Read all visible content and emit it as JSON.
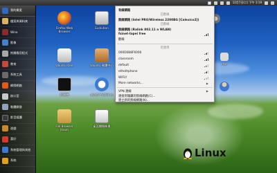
{
  "top_panel": {
    "clock": "12月7日(二) 下午 3:19"
  },
  "launcher": {
    "items": [
      {
        "label": "我的最愛",
        "color": "#2d6ac6",
        "icon": "star-icon"
      },
      {
        "label": "檔案與資料夾",
        "color": "#d9b360",
        "icon": "folder-icon"
      },
      {
        "label": "Wine",
        "color": "#8b2a2a",
        "icon": "wine-icon"
      },
      {
        "label": "影像",
        "color": "#4a7dc9",
        "icon": "image-icon"
      },
      {
        "label": "附屬應用程式",
        "color": "#a6a6a6",
        "icon": "accessories-icon"
      },
      {
        "label": "教育",
        "color": "#c64a3a",
        "icon": "education-icon"
      },
      {
        "label": "系統工具",
        "color": "#6a6a6a",
        "icon": "system-tools-icon"
      },
      {
        "label": "網際網路",
        "color": "#e05a18",
        "icon": "internet-icon"
      },
      {
        "label": "辦公室",
        "color": "#c8c8c8",
        "icon": "office-icon"
      },
      {
        "label": "軟體開發",
        "color": "#8fa3bd",
        "icon": "development-icon"
      },
      {
        "label": "影音媒體",
        "color": "#3a3a3a",
        "icon": "media-icon"
      },
      {
        "label": "遊戲",
        "color": "#c98a2a",
        "icon": "games-icon"
      },
      {
        "label": "喜好",
        "color": "#d23a2a",
        "icon": "preferences-icon"
      },
      {
        "label": "系統管理與其他",
        "color": "#3a7ad0",
        "icon": "administration-icon"
      },
      {
        "label": "系統",
        "color": "#e0a020",
        "icon": "system-icon"
      }
    ]
  },
  "desktop": {
    "icons": [
      {
        "label": "Firefox Web Browser",
        "color": "#e0641c"
      },
      {
        "label": "Evolution",
        "color": "#c6c6c6"
      },
      {
        "label": "Ubuntu One",
        "color": "#dcdcdc"
      },
      {
        "label": "Ubuntu 軟體中心",
        "color": "#c98a3a"
      },
      {
        "label": "終端機",
        "color": "#1a1a1a"
      },
      {
        "label": "avast! Antivirus",
        "color": "#3a7ad0"
      },
      {
        "label": "File Browser (Root)",
        "color": "#d9b360"
      },
      {
        "label": "桌面關閉佈景",
        "color": "#d8d8d8"
      }
    ],
    "right_icon_label": "rter",
    "logo_text": "Linux"
  },
  "network_menu": {
    "wired_header": "有線網路",
    "wired_status": "已斷線",
    "wireless1_header": "無線網路 (Intel PRO/Wireless 2200BG [Calexico2])",
    "wireless1_status": "已斷線",
    "wireless2_header": "無線網路 (Ralink 802.11 n WLAN)",
    "connected_network": "fsinet-tapei free",
    "disconnect_label": "斷線",
    "available_header": "可使用",
    "networks": [
      "000D0B8F6000",
      "classroom",
      "default",
      "ethothphone",
      "WIFLY"
    ],
    "more_networks": "More networks...",
    "vpn_label": "VPN 連線",
    "hidden_network": "連接到隱藏的無線網路(C)...",
    "create_network": "建立新的無線網路(N)..."
  }
}
